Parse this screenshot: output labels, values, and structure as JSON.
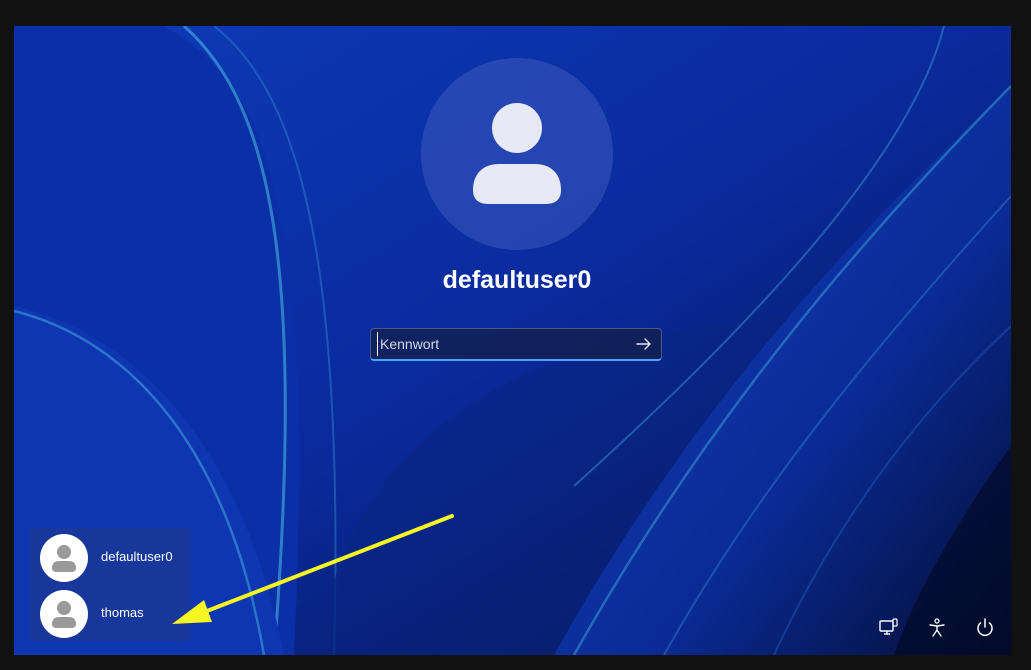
{
  "login": {
    "username": "defaultuser0",
    "password_placeholder": "Kennwort"
  },
  "user_list": {
    "items": [
      {
        "label": "defaultuser0"
      },
      {
        "label": "thomas"
      }
    ]
  },
  "icons": {
    "avatar": "user-silhouette-icon",
    "submit": "arrow-right-icon",
    "network": "network-icon",
    "accessibility": "accessibility-icon",
    "power": "power-icon"
  },
  "colors": {
    "background": "#0a2a9a",
    "annotation_arrow": "#f6f623",
    "input_underline": "#4aa3ff"
  }
}
